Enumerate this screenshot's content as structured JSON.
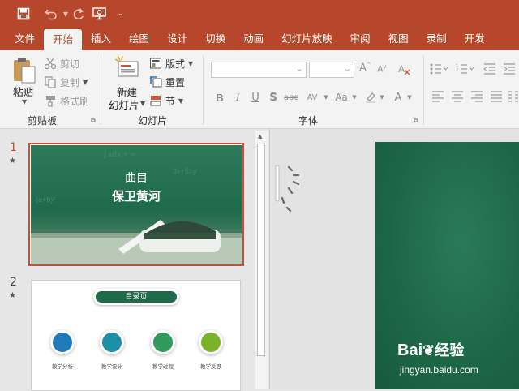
{
  "ribbon_tabs": [
    "文件",
    "开始",
    "插入",
    "绘图",
    "设计",
    "切换",
    "动画",
    "幻灯片放映",
    "审阅",
    "视图",
    "录制",
    "开发"
  ],
  "active_tab": "开始",
  "clipboard": {
    "paste": "粘贴",
    "cut": "剪切",
    "copy": "复制",
    "format_painter": "格式刷",
    "group_label": "剪贴板"
  },
  "slides_group": {
    "new_slide_line1": "新建",
    "new_slide_line2": "幻灯片",
    "layout": "版式",
    "reset": "重置",
    "section": "节",
    "group_label": "幻灯片"
  },
  "font_group": {
    "group_label": "字体",
    "font_name_value": "",
    "font_size_value": "",
    "bold": "B",
    "italic": "I",
    "underline": "U",
    "strikethrough": "S",
    "shadow": "abc"
  },
  "slides": [
    {
      "number": "1",
      "marker": "★",
      "subtitle": "曲目",
      "title": "保卫黄河"
    },
    {
      "number": "2",
      "marker": "★",
      "header": "目录页",
      "items": [
        "教学分析",
        "教学设计",
        "教学过程",
        "教学反思"
      ]
    }
  ],
  "watermark": {
    "brand": "Bai",
    "brand_cn": "经验",
    "url": "jingyan.baidu.com"
  },
  "colors": {
    "accent": "#b7472a",
    "slide_green": "#1f6a4b",
    "arrow_red": "#e8191b"
  }
}
